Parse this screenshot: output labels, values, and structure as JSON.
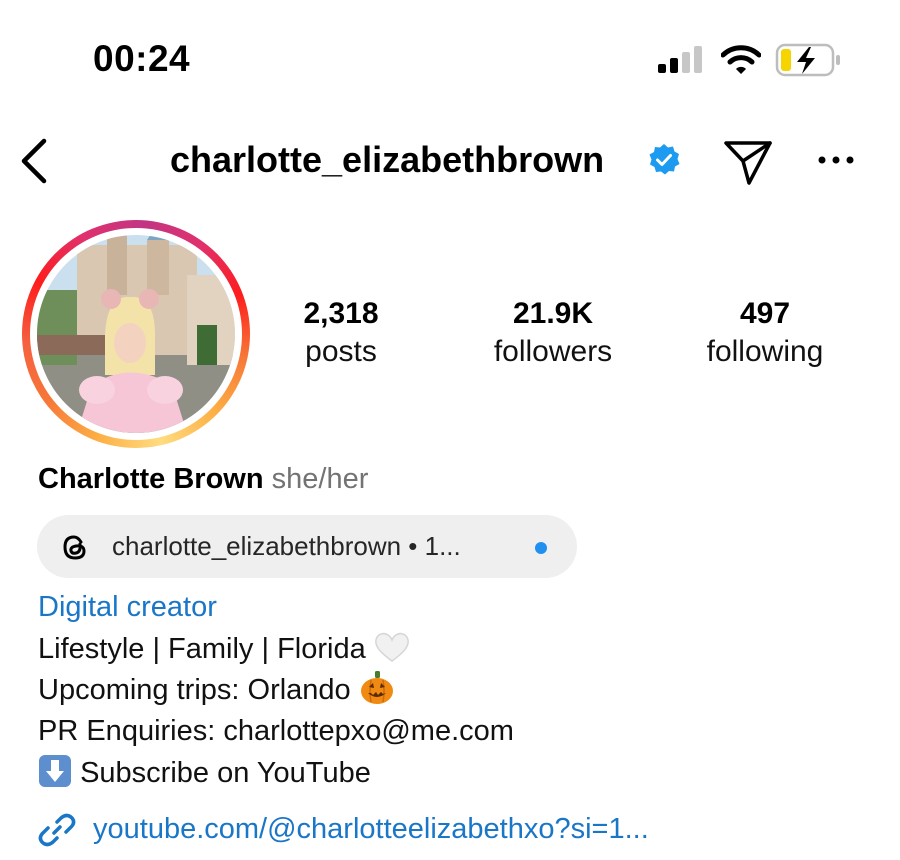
{
  "status_bar": {
    "time": "00:24",
    "signal_bars_filled": 2,
    "signal_bars_total": 4,
    "charging": true,
    "icons": [
      "signal-icon",
      "wifi-icon",
      "battery-charging-icon"
    ]
  },
  "header": {
    "username": "charlotte_elizabethbrown",
    "verified": true,
    "icons": [
      "back-chevron-icon",
      "verified-badge-icon",
      "send-message-icon",
      "more-options-icon"
    ]
  },
  "stats": {
    "posts": {
      "value": "2,318",
      "label": "posts"
    },
    "followers": {
      "value": "21.9K",
      "label": "followers"
    },
    "following": {
      "value": "497",
      "label": "following"
    }
  },
  "profile": {
    "full_name": "Charlotte Brown",
    "pronouns": "she/her",
    "threads_badge": "charlotte_elizabethbrown • 1...",
    "category": "Digital creator",
    "bio": {
      "line1": "Lifestyle | Family | Florida",
      "line2": "Upcoming trips: Orlando",
      "line3": "PR Enquiries: charlottepxo@me.com",
      "line4": "Subscribe on YouTube"
    },
    "bio_emojis": [
      "white-heart",
      "jack-o-lantern",
      "down-arrow-button"
    ],
    "link": "youtube.com/@charlotteelizabethxo?si=1..."
  },
  "colors": {
    "link_blue": "#1a76c7",
    "verified_blue": "#1d9bf0",
    "threads_dot": "#1f8ff0",
    "pill_bg": "#efefef",
    "battery_yellow": "#f5d400",
    "muted_text": "#737373"
  }
}
